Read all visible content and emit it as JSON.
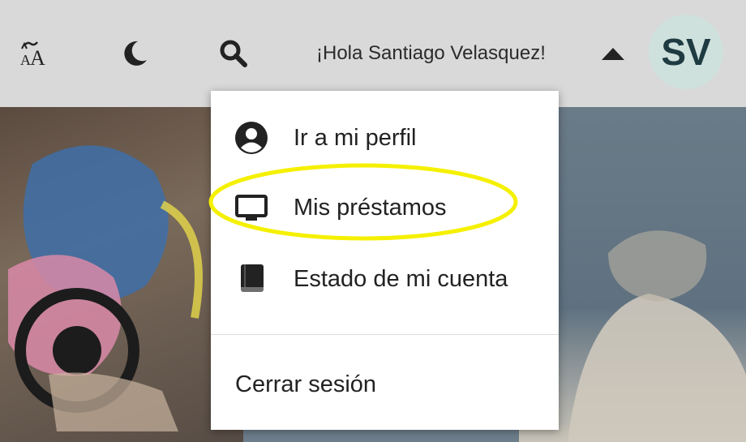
{
  "toolbar": {
    "icons": [
      "font-size-icon",
      "moon-icon",
      "search-icon"
    ],
    "greeting": "¡Hola Santiago Velasquez!",
    "caret_icon": "caret-up-icon",
    "avatar_initials": "SV",
    "background_color": "#d9d9d9",
    "avatar_color": "#cfe1dd"
  },
  "user_menu": {
    "items": [
      {
        "label": "Ir a mi perfil",
        "icon": "account-circle-icon"
      },
      {
        "label": "Mis préstamos",
        "icon": "monitor-icon",
        "highlighted": true
      },
      {
        "label": "Estado de mi cuenta",
        "icon": "book-icon"
      }
    ],
    "logout_label": "Cerrar sesión",
    "highlight_color": "#f5f000"
  }
}
